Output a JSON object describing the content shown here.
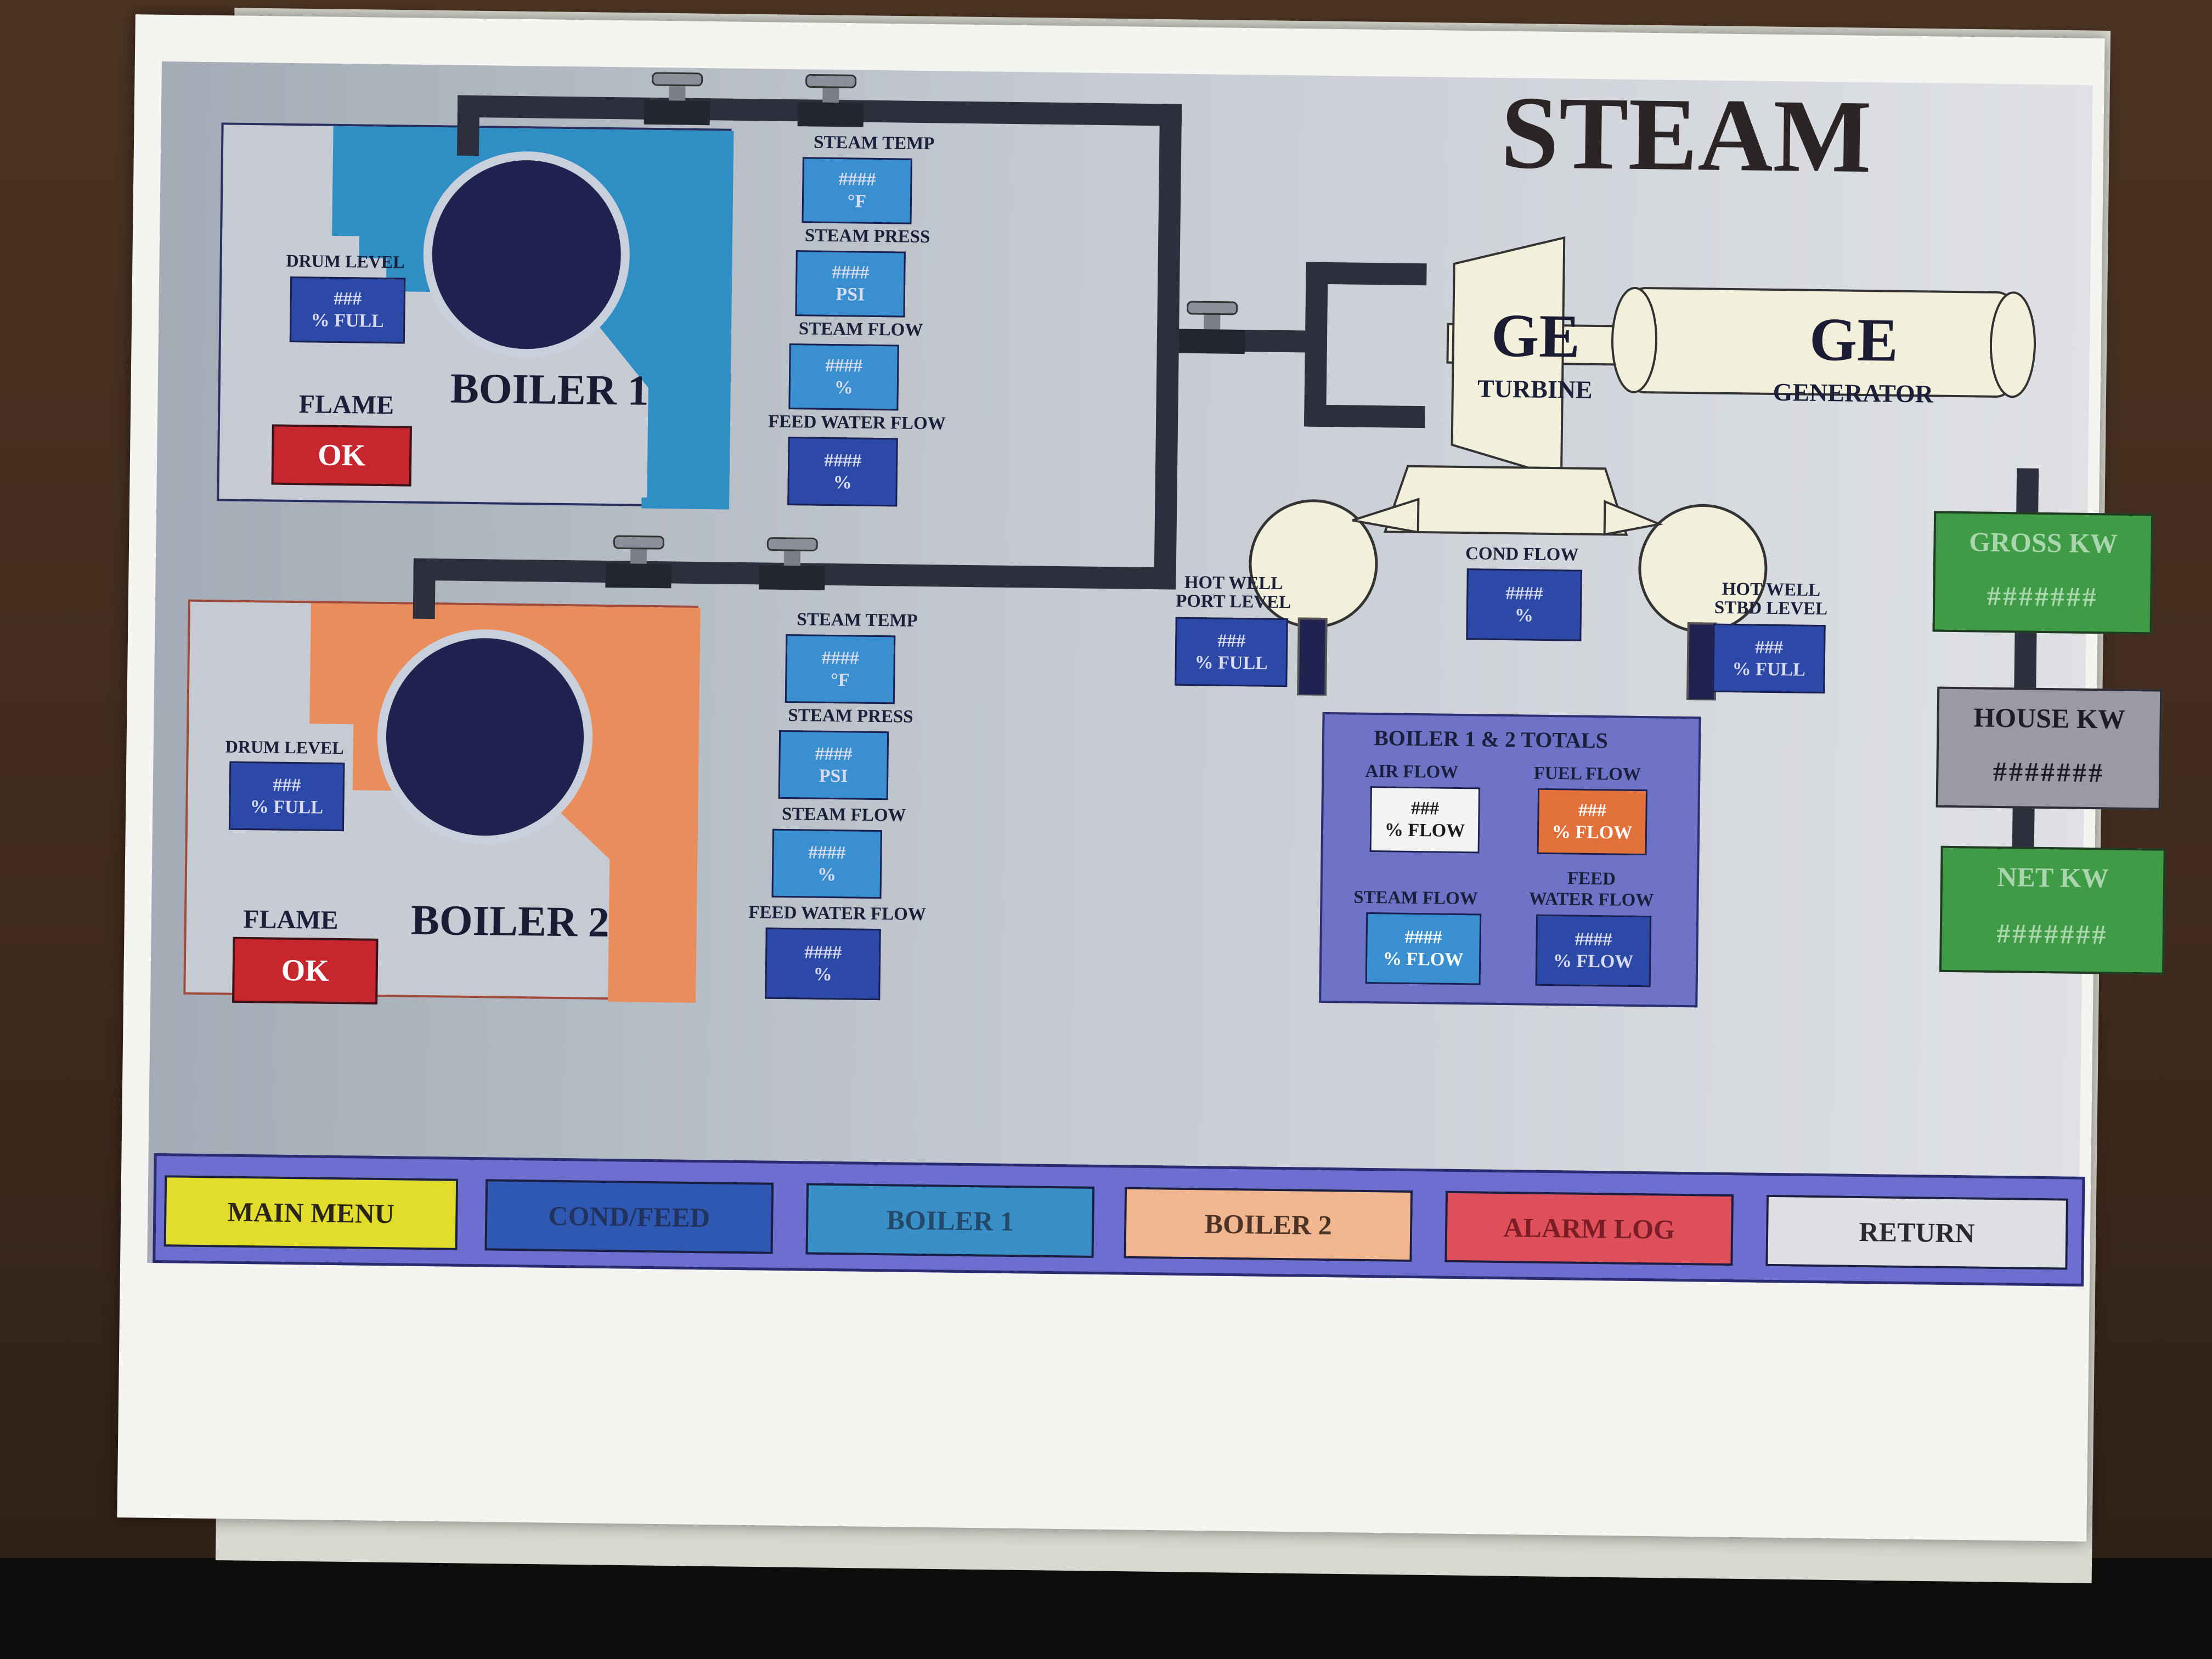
{
  "screen_title": "STEAM",
  "boiler1": {
    "name": "BOILER 1",
    "drum_level": {
      "label": "DRUM LEVEL",
      "value": "###",
      "unit": "% FULL"
    },
    "flame": {
      "label": "FLAME",
      "status": "OK"
    },
    "steam_temp": {
      "label": "STEAM TEMP",
      "value": "####",
      "unit": "°F"
    },
    "steam_press": {
      "label": "STEAM PRESS",
      "value": "####",
      "unit": "PSI"
    },
    "steam_flow": {
      "label": "STEAM FLOW",
      "value": "####",
      "unit": "%"
    },
    "feed_water_flow": {
      "label": "FEED WATER FLOW",
      "value": "####",
      "unit": "%"
    }
  },
  "boiler2": {
    "name": "BOILER 2",
    "drum_level": {
      "label": "DRUM LEVEL",
      "value": "###",
      "unit": "% FULL"
    },
    "flame": {
      "label": "FLAME",
      "status": "OK"
    },
    "steam_temp": {
      "label": "STEAM TEMP",
      "value": "####",
      "unit": "°F"
    },
    "steam_press": {
      "label": "STEAM PRESS",
      "value": "####",
      "unit": "PSI"
    },
    "steam_flow": {
      "label": "STEAM FLOW",
      "value": "####",
      "unit": "%"
    },
    "feed_water_flow": {
      "label": "FEED WATER FLOW",
      "value": "####",
      "unit": "%"
    }
  },
  "turbine": {
    "brand": "GE",
    "label": "TURBINE"
  },
  "generator": {
    "brand": "GE",
    "label": "GENERATOR"
  },
  "cond_flow": {
    "label": "COND FLOW",
    "value": "####",
    "unit": "%"
  },
  "hot_well_port": {
    "label_line1": "HOT WELL",
    "label_line2": "PORT LEVEL",
    "value": "###",
    "unit": "% FULL"
  },
  "hot_well_stbd": {
    "label_line1": "HOT WELL",
    "label_line2": "STBD LEVEL",
    "value": "###",
    "unit": "% FULL"
  },
  "totals": {
    "title": "BOILER 1 & 2 TOTALS",
    "air_flow": {
      "label": "AIR FLOW",
      "value": "###",
      "unit": "% FLOW"
    },
    "fuel_flow": {
      "label": "FUEL FLOW",
      "value": "###",
      "unit": "% FLOW"
    },
    "steam_flow": {
      "label": "STEAM FLOW",
      "value": "####",
      "unit": "% FLOW"
    },
    "feed_water_flow": {
      "label_line1": "FEED",
      "label_line2": "WATER FLOW",
      "value": "####",
      "unit": "% FLOW"
    }
  },
  "power": {
    "gross": {
      "label": "GROSS KW",
      "value": "#######"
    },
    "house": {
      "label": "HOUSE KW",
      "value": "#######"
    },
    "net": {
      "label": "NET KW",
      "value": "#######"
    }
  },
  "nav": {
    "main_menu": "MAIN MENU",
    "cond_feed": "COND/FEED",
    "boiler1": "BOILER 1",
    "boiler2": "BOILER 2",
    "alarm_log": "ALARM LOG",
    "return": "RETURN"
  },
  "colors": {
    "boiler1_accent": "#2f8fc4",
    "boiler2_accent": "#e98d5c",
    "value_box": "#2c49a8",
    "flame_ok": "#c8262e",
    "power_green": "#3f9b45",
    "house_gray": "#9a9aa4",
    "totals_panel": "#6f73c8",
    "nav_bar": "#6d6fd0"
  }
}
